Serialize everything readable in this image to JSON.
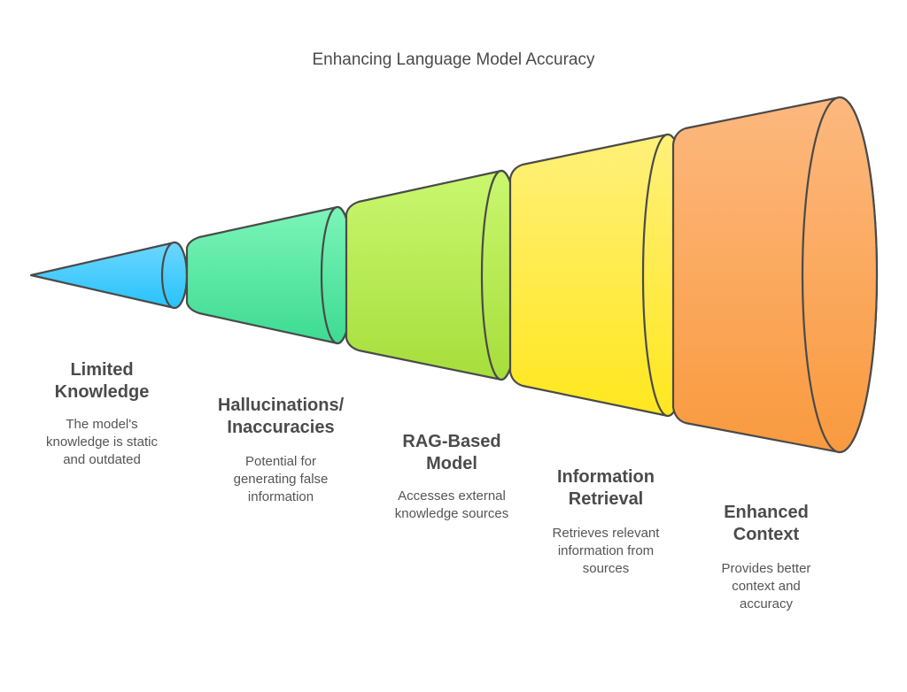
{
  "title": "Enhancing Language Model Accuracy",
  "stages": [
    {
      "heading_line1": "Limited",
      "heading_line2": "Knowledge",
      "desc_line1": "The model's",
      "desc_line2": "knowledge is static",
      "desc_line3": "and outdated",
      "color_top": "#6dd6ff",
      "color_bottom": "#27c3fb"
    },
    {
      "heading_line1": "Hallucinations/",
      "heading_line2": "Inaccuracies",
      "desc_line1": "Potential for",
      "desc_line2": "generating false",
      "desc_line3": "information",
      "color_top": "#7bf5b7",
      "color_bottom": "#3ddb92"
    },
    {
      "heading_line1": "RAG-Based",
      "heading_line2": "Model",
      "desc_line1": "Accesses external",
      "desc_line2": "knowledge sources",
      "desc_line3": "",
      "color_top": "#c9f76f",
      "color_bottom": "#a6de3b"
    },
    {
      "heading_line1": "Information",
      "heading_line2": "Retrieval",
      "desc_line1": "Retrieves relevant",
      "desc_line2": "information from",
      "desc_line3": "sources",
      "color_top": "#fff07a",
      "color_bottom": "#ffe71e"
    },
    {
      "heading_line1": "Enhanced",
      "heading_line2": "Context",
      "desc_line1": "Provides better",
      "desc_line2": "context and",
      "desc_line3": "accuracy",
      "color_top": "#fdb87e",
      "color_bottom": "#f99a3f"
    }
  ],
  "stroke_color": "#4a4a4a"
}
